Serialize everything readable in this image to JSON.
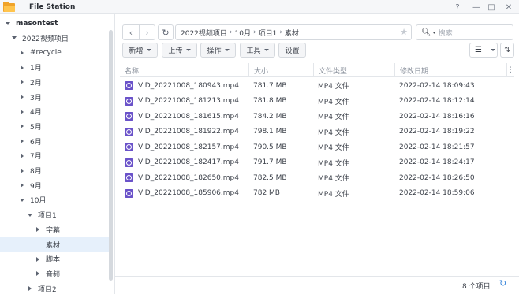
{
  "window": {
    "title": "File Station",
    "controls": [
      "?",
      "—",
      "□",
      "✕"
    ]
  },
  "sidebar": {
    "items": [
      {
        "label": "masontest",
        "level": 0,
        "arrow": "down",
        "root": true
      },
      {
        "label": "2022视频项目",
        "level": 1,
        "arrow": "down"
      },
      {
        "label": "#recycle",
        "level": 2,
        "arrow": "right"
      },
      {
        "label": "1月",
        "level": 2,
        "arrow": "right"
      },
      {
        "label": "2月",
        "level": 2,
        "arrow": "right"
      },
      {
        "label": "3月",
        "level": 2,
        "arrow": "right"
      },
      {
        "label": "4月",
        "level": 2,
        "arrow": "right"
      },
      {
        "label": "5月",
        "level": 2,
        "arrow": "right"
      },
      {
        "label": "6月",
        "level": 2,
        "arrow": "right"
      },
      {
        "label": "7月",
        "level": 2,
        "arrow": "right"
      },
      {
        "label": "8月",
        "level": 2,
        "arrow": "right"
      },
      {
        "label": "9月",
        "level": 2,
        "arrow": "right"
      },
      {
        "label": "10月",
        "level": 2,
        "arrow": "down"
      },
      {
        "label": "项目1",
        "level": 3,
        "arrow": "down"
      },
      {
        "label": "字幕",
        "level": 4,
        "arrow": "right"
      },
      {
        "label": "素材",
        "level": 4,
        "arrow": "none",
        "selected": true
      },
      {
        "label": "脚本",
        "level": 4,
        "arrow": "right"
      },
      {
        "label": "音频",
        "level": 4,
        "arrow": "right"
      },
      {
        "label": "项目2",
        "level": 3,
        "arrow": "right"
      }
    ]
  },
  "path": {
    "segments": [
      "2022视频项目",
      "10月",
      "项目1",
      "素材"
    ],
    "separator": "›"
  },
  "search": {
    "placeholder": "搜索"
  },
  "toolbar": {
    "buttons": [
      "新增",
      "上传",
      "操作",
      "工具",
      "设置"
    ]
  },
  "table": {
    "columns": [
      "名称",
      "大小",
      "文件类型",
      "修改日期"
    ],
    "rows": [
      {
        "name": "VID_20221008_180943.mp4",
        "size": "781.7 MB",
        "type": "MP4 文件",
        "modified": "2022-02-14 18:09:43"
      },
      {
        "name": "VID_20221008_181213.mp4",
        "size": "781.8 MB",
        "type": "MP4 文件",
        "modified": "2022-02-14 18:12:14"
      },
      {
        "name": "VID_20221008_181615.mp4",
        "size": "784.2 MB",
        "type": "MP4 文件",
        "modified": "2022-02-14 18:16:16"
      },
      {
        "name": "VID_20221008_181922.mp4",
        "size": "798.1 MB",
        "type": "MP4 文件",
        "modified": "2022-02-14 18:19:22"
      },
      {
        "name": "VID_20221008_182157.mp4",
        "size": "790.5 MB",
        "type": "MP4 文件",
        "modified": "2022-02-14 18:21:57"
      },
      {
        "name": "VID_20221008_182417.mp4",
        "size": "791.7 MB",
        "type": "MP4 文件",
        "modified": "2022-02-14 18:24:17"
      },
      {
        "name": "VID_20221008_182650.mp4",
        "size": "782.5 MB",
        "type": "MP4 文件",
        "modified": "2022-02-14 18:26:50"
      },
      {
        "name": "VID_20221008_185906.mp4",
        "size": "782 MB",
        "type": "MP4 文件",
        "modified": "2022-02-14 18:59:06"
      }
    ]
  },
  "status": {
    "count": "8 个项目"
  },
  "icons": {
    "file": "video-file-icon",
    "refresh": "refresh-icon",
    "search": "search-icon",
    "star": "star-icon"
  },
  "colors": {
    "accent": "#2d7fd8",
    "video_icon": "#6a52c9",
    "folder": "#f0a32a"
  }
}
